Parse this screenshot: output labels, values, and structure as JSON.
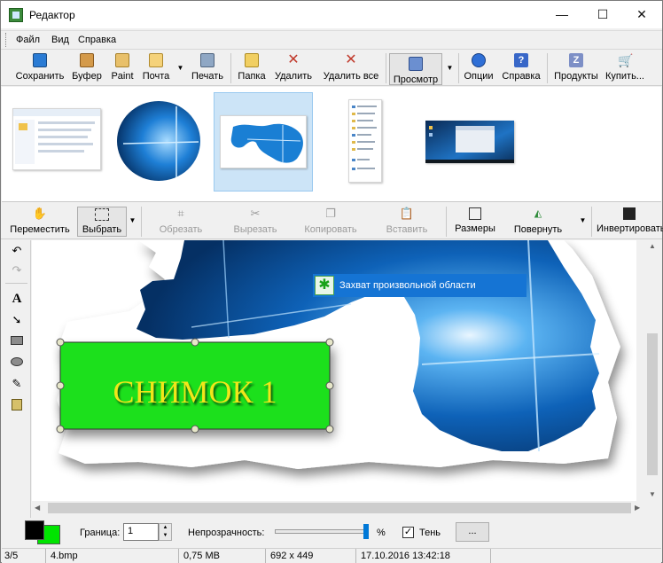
{
  "window": {
    "title": "Редактор",
    "minimize_glyph": "—",
    "maximize_glyph": "☐",
    "close_glyph": "✕"
  },
  "menu": {
    "items": [
      "Файл",
      "Вид",
      "Справка"
    ]
  },
  "toolbar": {
    "save": "Сохранить",
    "clipboard": "Буфер",
    "paint": "Paint",
    "mail": "Почта",
    "print": "Печать",
    "folder": "Папка",
    "delete": "Удалить",
    "delete_all": "Удалить все",
    "view": "Просмотр",
    "options": "Опции",
    "help": "Справка",
    "products": "Продукты",
    "buy": "Купить..."
  },
  "edit_toolbar": {
    "move": "Переместить",
    "select": "Выбрать",
    "crop": "Обрезать",
    "cut": "Вырезать",
    "copy": "Копировать",
    "paste": "Вставить",
    "size": "Размеры",
    "rotate": "Повернуть",
    "invert": "Инвертировать"
  },
  "canvas": {
    "tooltip": "Захват произвольной области",
    "stamp_text": "СНИМОК 1"
  },
  "options": {
    "border_label": "Граница:",
    "border_value": "1",
    "opacity_label": "Непрозрачность:",
    "percent_sign": "%",
    "shadow_label": "Тень",
    "shadow_checked": "✓",
    "more_button": "..."
  },
  "colors": {
    "foreground": "#000000",
    "background": "#00e400",
    "selection": "#cce4f7",
    "accent": "#0078d7"
  },
  "status": {
    "index": "3/5",
    "filename": "4.bmp",
    "filesize": "0,75 МВ",
    "dimensions": "692 x 449",
    "datetime": "17.10.2016 13:42:18"
  }
}
